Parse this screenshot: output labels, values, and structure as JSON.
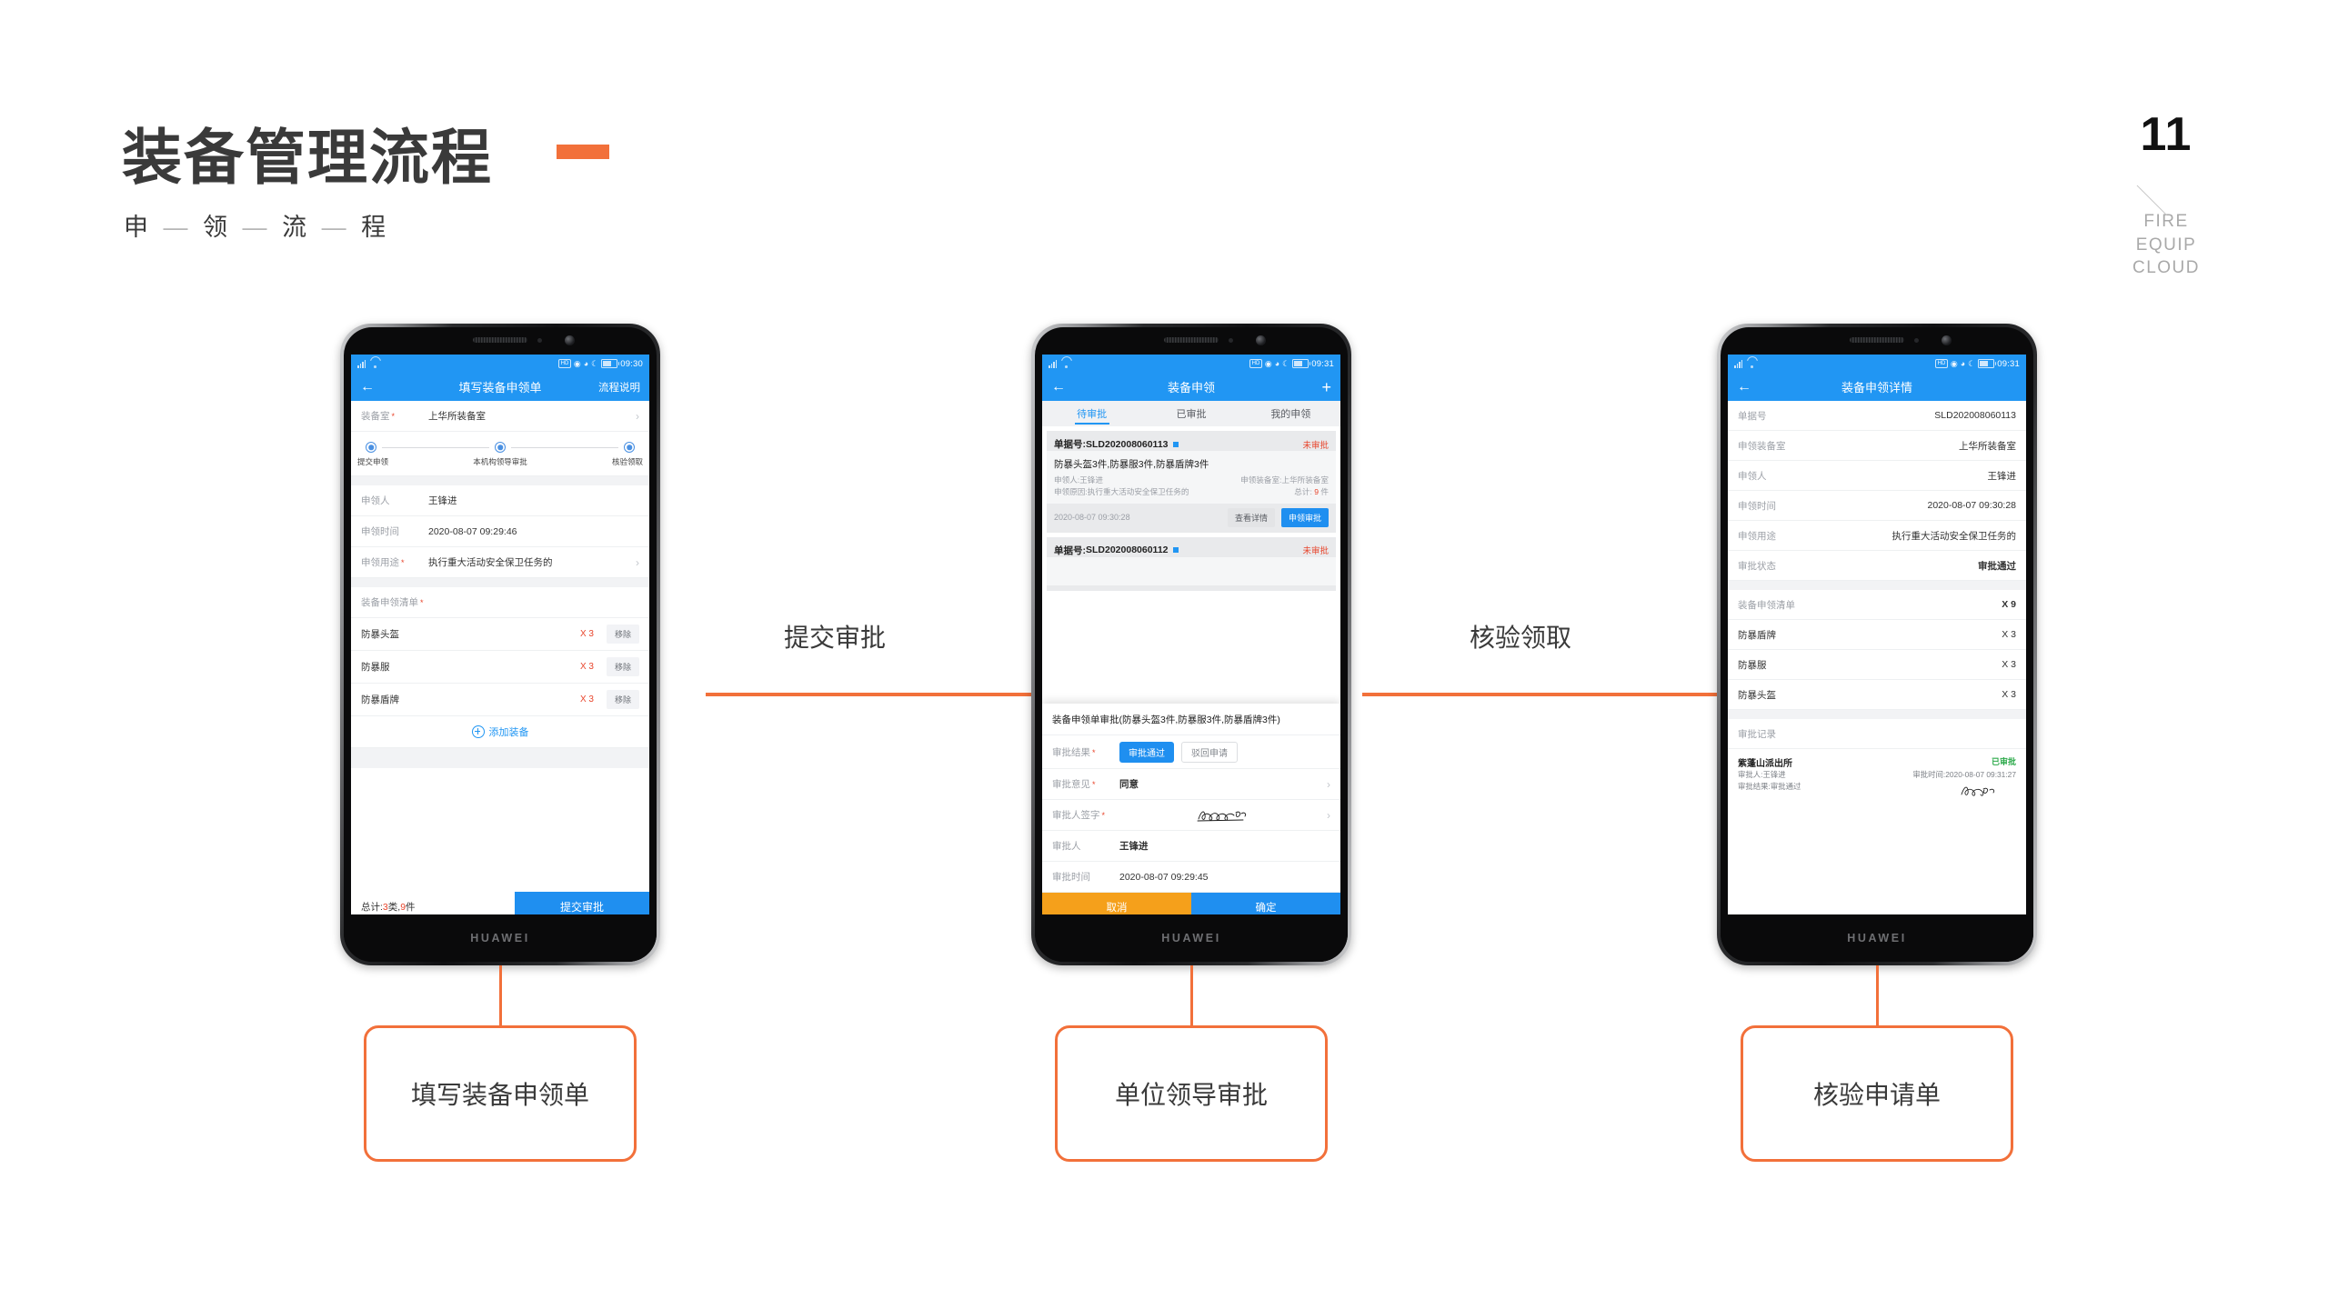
{
  "header": {
    "title": "装备管理流程",
    "subtitle_parts": [
      "申",
      "领",
      "流",
      "程"
    ],
    "subtitle_dash": "—"
  },
  "brand": {
    "number": "11",
    "lines": [
      "FIRE",
      "EQUIP",
      "CLOUD"
    ]
  },
  "colors": {
    "accent_orange": "#f2703a",
    "primary_blue": "#2196f3",
    "button_blue": "#1f8ff0",
    "warn_orange": "#f5a01b",
    "danger_red": "#e8452c",
    "success_green": "#2eaa4c",
    "title_gray": "#3a3a3a"
  },
  "arrows": [
    {
      "label": "提交审批"
    },
    {
      "label": "核验领取"
    }
  ],
  "callouts": [
    {
      "label": "填写装备申领单"
    },
    {
      "label": "单位领导审批"
    },
    {
      "label": "核验申请单"
    }
  ],
  "phone_brand": "HUAWEI",
  "phone1": {
    "statusbar": {
      "time": "09:30",
      "hd": "HD"
    },
    "nav": {
      "back": "←",
      "title": "填写装备申领单",
      "right": "流程说明"
    },
    "equip_room": {
      "label": "装备室",
      "value": "上华所装备室"
    },
    "steps": [
      {
        "label": "提交申领"
      },
      {
        "label": "本机构领导审批"
      },
      {
        "label": "核验领取"
      }
    ],
    "fields": [
      {
        "label": "申领人",
        "value": "王锋进",
        "required": false,
        "chevron": false
      },
      {
        "label": "申领时间",
        "value": "2020-08-07 09:29:46",
        "required": false,
        "chevron": false
      },
      {
        "label": "申领用途",
        "value": "执行重大活动安全保卫任务的",
        "required": true,
        "chevron": true
      }
    ],
    "list_title": "装备申领清单",
    "items": [
      {
        "name": "防暴头盔",
        "qty": "X 3",
        "action": "移除"
      },
      {
        "name": "防暴服",
        "qty": "X 3",
        "action": "移除"
      },
      {
        "name": "防暴盾牌",
        "qty": "X 3",
        "action": "移除"
      }
    ],
    "add_label": "添加装备",
    "total_prefix": "总计:",
    "total_types": "3",
    "total_types_unit": " 类,",
    "total_count": "9",
    "total_count_unit": " 件",
    "submit_label": "提交审批"
  },
  "phone2": {
    "statusbar": {
      "time": "09:31",
      "hd": "HD"
    },
    "nav": {
      "back": "←",
      "title": "装备申领",
      "right": "+"
    },
    "tabs": [
      {
        "label": "待审批",
        "active": true
      },
      {
        "label": "已审批",
        "active": false
      },
      {
        "label": "我的申领",
        "active": false
      }
    ],
    "cards": [
      {
        "no_label": "单据号:",
        "no": "SLD202008060113",
        "status": "未审批",
        "title": "防暴头盔3件,防暴服3件,防暴盾牌3件",
        "applicant_label": "申领人:",
        "applicant": "王锋进",
        "room_label": "申领装备室:",
        "room": "上华所装备室",
        "reason_label": "申领原因:",
        "reason": "执行重大活动安全保卫任务的",
        "total_label": "总计: ",
        "total": "9",
        "total_unit": " 件",
        "time": "2020-08-07 09:30:28",
        "btn_detail": "查看详情",
        "btn_approve": "申领审批"
      },
      {
        "no_label": "单据号:",
        "no": "SLD202008060112",
        "status": "未审批"
      }
    ],
    "sheet": {
      "title": "装备申领单审批(防暴头盔3件,防暴服3件,防暴盾牌3件)",
      "result_label": "审批结果",
      "result_pass": "审批通过",
      "result_reject": "驳回申请",
      "opinion_label": "审批意见",
      "opinion_value": "同意",
      "sign_label": "审批人签字",
      "approver_label": "审批人",
      "approver_value": "王锋进",
      "time_label": "审批时间",
      "time_value": "2020-08-07 09:29:45",
      "cancel": "取消",
      "confirm": "确定"
    }
  },
  "phone3": {
    "statusbar": {
      "time": "09:31",
      "hd": "HD"
    },
    "nav": {
      "back": "←",
      "title": "装备申领详情"
    },
    "rows": [
      {
        "label": "单据号",
        "value": "SLD202008060113",
        "style": "normal"
      },
      {
        "label": "申领装备室",
        "value": "上华所装备室",
        "style": "normal"
      },
      {
        "label": "申领人",
        "value": "王锋进",
        "style": "normal"
      },
      {
        "label": "申领时间",
        "value": "2020-08-07 09:30:28",
        "style": "normal"
      },
      {
        "label": "申领用途",
        "value": "执行重大活动安全保卫任务的",
        "style": "normal"
      },
      {
        "label": "审批状态",
        "value": "审批通过",
        "style": "green"
      }
    ],
    "list_title": "装备申领清单",
    "list_total": "X 9",
    "items": [
      {
        "name": "防暴盾牌",
        "qty": "X 3"
      },
      {
        "name": "防暴服",
        "qty": "X 3"
      },
      {
        "name": "防暴头盔",
        "qty": "X 3"
      }
    ],
    "record_title": "审批记录",
    "record": {
      "org": "紫蓬山派出所",
      "state": "已审批",
      "approver_label": "审批人:",
      "approver": "王锋进",
      "time_label": "审批时间:",
      "time": "2020-08-07 09:31:27",
      "result_label": "审批结果:",
      "result": "审批通过"
    }
  }
}
